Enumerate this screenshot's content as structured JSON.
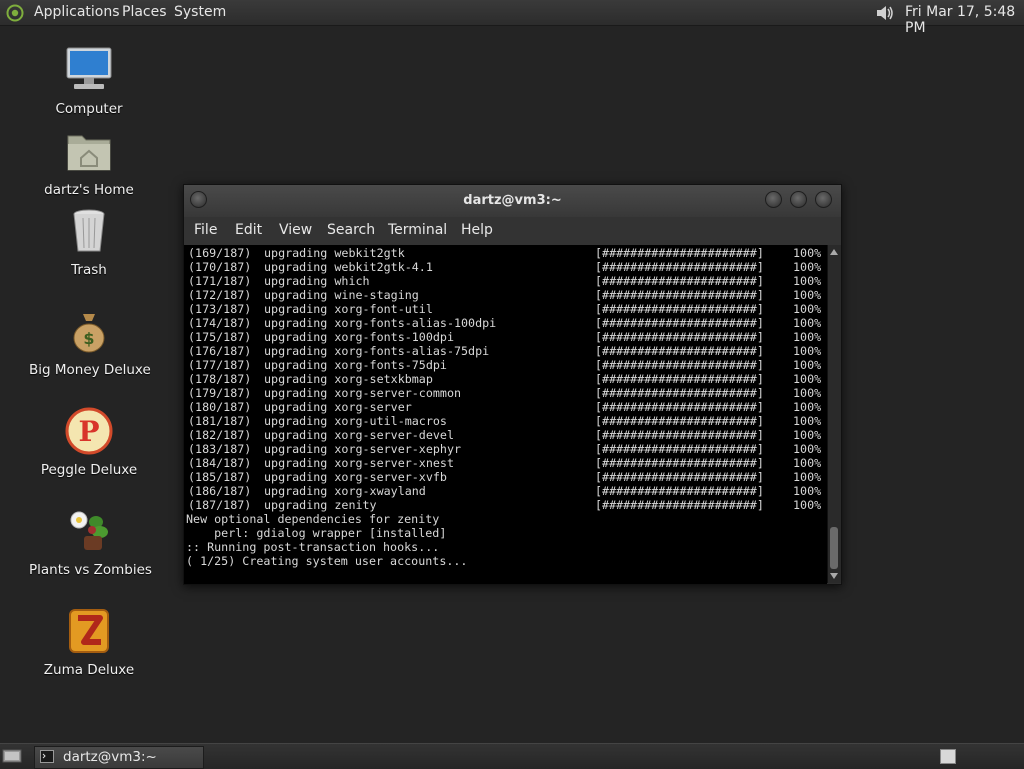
{
  "top_panel": {
    "menus": [
      "Applications",
      "Places",
      "System"
    ],
    "clock": "Fri Mar 17,  5:48 PM"
  },
  "desktop_icons": [
    {
      "label": "Computer",
      "icon": "computer-icon"
    },
    {
      "label": "dartz's Home",
      "icon": "home-folder-icon"
    },
    {
      "label": "Trash",
      "icon": "trash-icon"
    },
    {
      "label": "Big Money Deluxe",
      "icon": "money-bag-icon"
    },
    {
      "label": "Peggle Deluxe",
      "icon": "peggle-icon"
    },
    {
      "label": "Plants vs Zombies",
      "icon": "plants-vs-zombies-icon"
    },
    {
      "label": "Zuma Deluxe",
      "icon": "zuma-icon"
    }
  ],
  "terminal": {
    "title": "dartz@vm3:~",
    "menu": [
      "File",
      "Edit",
      "View",
      "Search",
      "Terminal",
      "Help"
    ],
    "progress_bar": "[######################]",
    "progress_pct": "100%",
    "upgrade_lines": [
      [
        "(169/187)",
        "upgrading webkit2gtk"
      ],
      [
        "(170/187)",
        "upgrading webkit2gtk-4.1"
      ],
      [
        "(171/187)",
        "upgrading which"
      ],
      [
        "(172/187)",
        "upgrading wine-staging"
      ],
      [
        "(173/187)",
        "upgrading xorg-font-util"
      ],
      [
        "(174/187)",
        "upgrading xorg-fonts-alias-100dpi"
      ],
      [
        "(175/187)",
        "upgrading xorg-fonts-100dpi"
      ],
      [
        "(176/187)",
        "upgrading xorg-fonts-alias-75dpi"
      ],
      [
        "(177/187)",
        "upgrading xorg-fonts-75dpi"
      ],
      [
        "(178/187)",
        "upgrading xorg-setxkbmap"
      ],
      [
        "(179/187)",
        "upgrading xorg-server-common"
      ],
      [
        "(180/187)",
        "upgrading xorg-server"
      ],
      [
        "(181/187)",
        "upgrading xorg-util-macros"
      ],
      [
        "(182/187)",
        "upgrading xorg-server-devel"
      ],
      [
        "(183/187)",
        "upgrading xorg-server-xephyr"
      ],
      [
        "(184/187)",
        "upgrading xorg-server-xnest"
      ],
      [
        "(185/187)",
        "upgrading xorg-server-xvfb"
      ],
      [
        "(186/187)",
        "upgrading xorg-xwayland"
      ],
      [
        "(187/187)",
        "upgrading zenity"
      ]
    ],
    "tail_lines": [
      "New optional dependencies for zenity",
      "    perl: gdialog wrapper [installed]",
      ":: Running post-transaction hooks...",
      "( 1/25) Creating system user accounts..."
    ]
  },
  "taskbar": {
    "task_label": "dartz@vm3:~"
  }
}
